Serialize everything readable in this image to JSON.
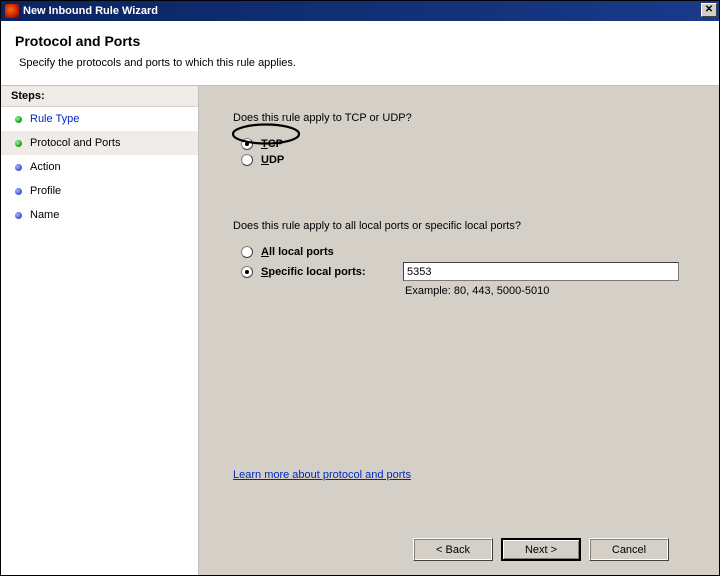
{
  "window": {
    "title": "New Inbound Rule Wizard"
  },
  "header": {
    "title": "Protocol and Ports",
    "subtitle": "Specify the protocols and ports to which this rule applies."
  },
  "sidebar": {
    "heading": "Steps:",
    "items": [
      {
        "label": "Rule Type",
        "bullet": "green",
        "state": "link"
      },
      {
        "label": "Protocol and Ports",
        "bullet": "green",
        "state": "active"
      },
      {
        "label": "Action",
        "bullet": "blue",
        "state": "future"
      },
      {
        "label": "Profile",
        "bullet": "blue",
        "state": "future"
      },
      {
        "label": "Name",
        "bullet": "blue",
        "state": "future"
      }
    ]
  },
  "main": {
    "q1": "Does this rule apply to TCP or UDP?",
    "tcp_label": "TCP",
    "udp_label": "UDP",
    "protocol_selected": "TCP",
    "q2": "Does this rule apply to all local ports or specific local ports?",
    "all_ports_label": "All local ports",
    "specific_ports_label": "Specific local ports:",
    "port_scope_selected": "specific",
    "port_value": "5353",
    "example_text": "Example: 80, 443, 5000-5010",
    "learn_link": "Learn more about protocol and ports"
  },
  "buttons": {
    "back": "< Back",
    "next": "Next >",
    "cancel": "Cancel"
  }
}
